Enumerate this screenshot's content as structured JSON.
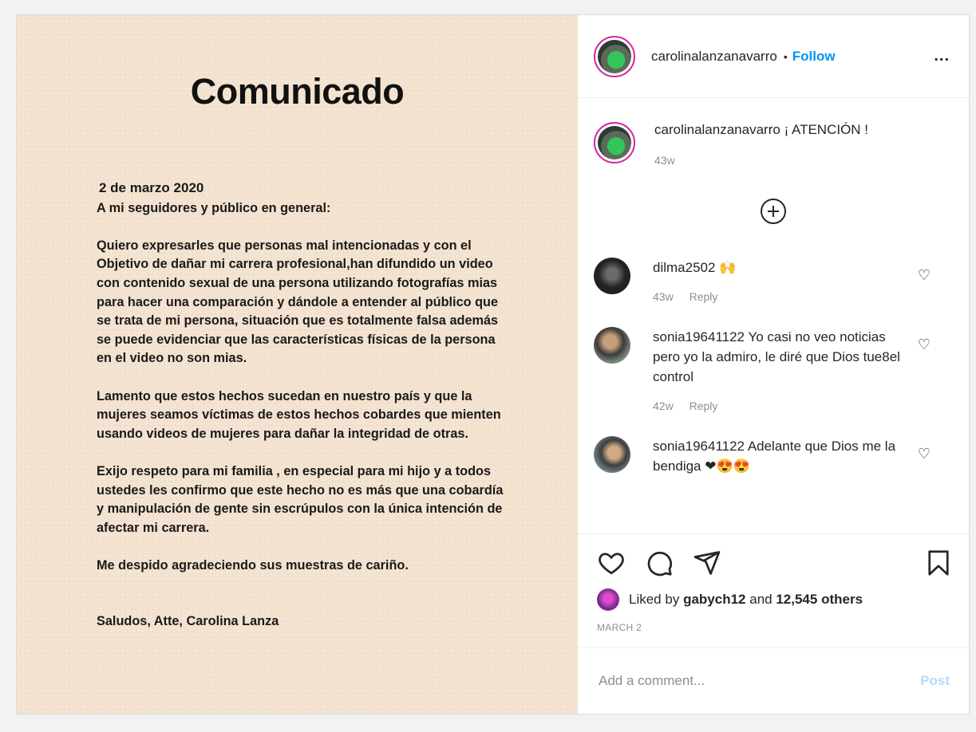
{
  "image": {
    "title": "Comunicado",
    "date": "2 de marzo 2020",
    "greeting": "A mi seguidores y público en general:",
    "paragraphs": [
      "Quiero expresarles que personas mal intencionadas y con el Objetivo de dañar mi carrera profesional,han difundido un video con contenido sexual de una persona utilizando fotografías mias para hacer una comparación y dándole a entender al público que se trata de mi persona, situación que es totalmente falsa además se puede evidenciar que las características físicas de la persona en el video no son mias.",
      "Lamento que estos hechos sucedan en nuestro país y que la mujeres seamos víctimas de estos hechos cobardes que mienten usando videos de mujeres para dañar la integridad de otras.",
      "Exijo respeto para mi familia , en especial para mi hijo y a todos ustedes  les confirmo que este hecho no es más que una cobardía y manipulación de gente sin escrúpulos con la única intención de afectar mi carrera.",
      "Me despido agradeciendo sus muestras de cariño."
    ],
    "signature": "Saludos, Atte, Carolina Lanza"
  },
  "header": {
    "username": "carolinalanzanavarro",
    "separator": "•",
    "follow_label": "Follow",
    "more_label": "..."
  },
  "caption": {
    "username": "carolinalanzanavarro",
    "text": "¡ ATENCIÓN !",
    "age": "43w"
  },
  "comments": [
    {
      "username": "dilma2502",
      "text": "🙌",
      "age": "43w",
      "reply_label": "Reply"
    },
    {
      "username": "sonia19641122",
      "text": "Yo casi no veo noticias pero yo la admiro, le diré que Dios tue8el control",
      "age": "42w",
      "reply_label": "Reply"
    },
    {
      "username": "sonia19641122",
      "text": "Adelante que Dios me la bendiga ❤😍😍",
      "age": "",
      "reply_label": ""
    }
  ],
  "likes": {
    "prefix": "Liked by",
    "user": "gabych12",
    "and": "and",
    "count": "12,545 others"
  },
  "post_date": "MARCH 2",
  "add_comment": {
    "placeholder": "Add a comment...",
    "post_label": "Post"
  },
  "colors": {
    "accent": "#0095f6",
    "paper": "#f3e2cf",
    "post_disabled": "#b3dbff"
  }
}
